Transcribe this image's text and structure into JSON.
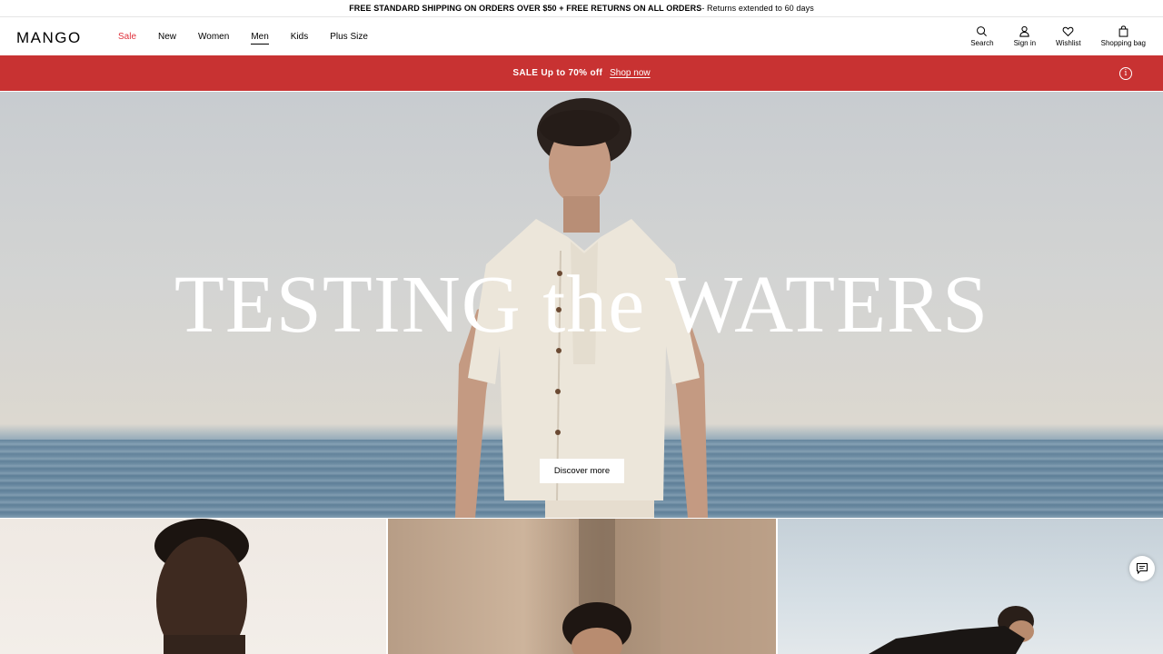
{
  "topbar": {
    "shipping_bold": "FREE STANDARD SHIPPING ON ORDERS OVER $50 + FREE RETURNS ON ALL ORDERS",
    "shipping_light": " - Returns extended to 60 days"
  },
  "header": {
    "logo": "MANGO",
    "nav": [
      {
        "label": "Sale"
      },
      {
        "label": "New"
      },
      {
        "label": "Women"
      },
      {
        "label": "Men"
      },
      {
        "label": "Kids"
      },
      {
        "label": "Plus Size"
      }
    ],
    "utils": {
      "search": "Search",
      "signin": "Sign in",
      "wishlist": "Wishlist",
      "bag": "Shopping bag"
    }
  },
  "promo": {
    "text": "SALE Up to 70% off",
    "link": "Shop now",
    "info_icon": "info-icon"
  },
  "hero": {
    "title": "TESTING the WATERS",
    "cta": "Discover more"
  },
  "colors": {
    "sale_accent": "#e0323c",
    "promo_bg": "#c83232"
  }
}
